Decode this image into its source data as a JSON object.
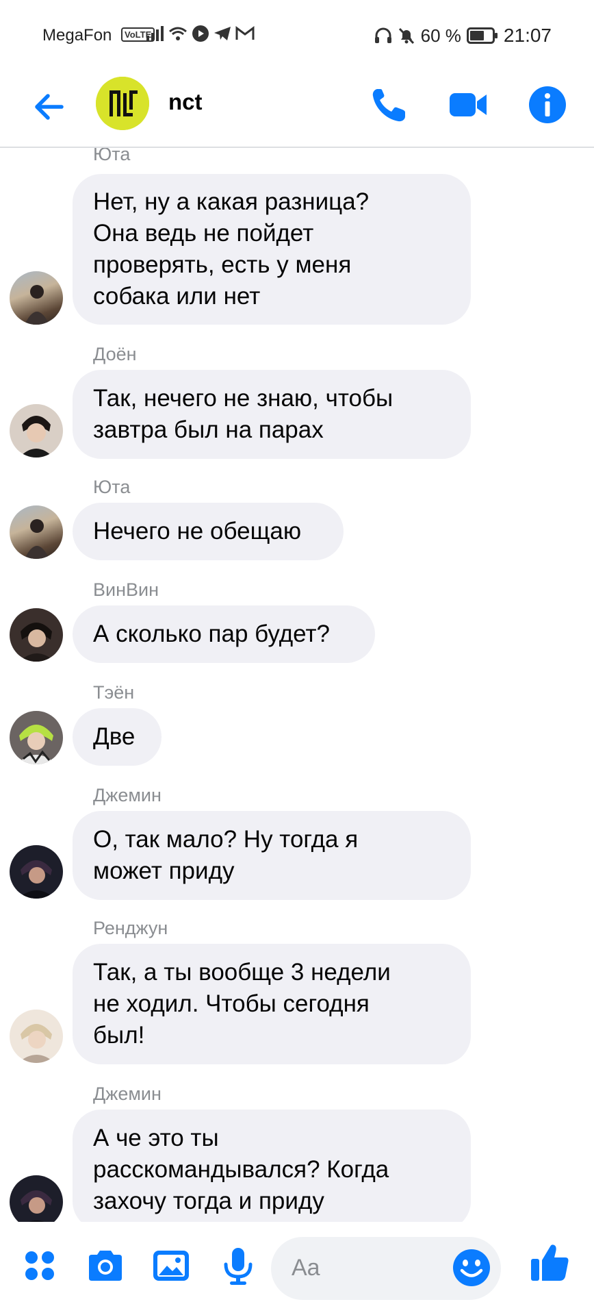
{
  "status_bar": {
    "carrier": "MegaFon",
    "volte": "VoLTE",
    "battery": "60 %",
    "time": "21:07"
  },
  "header": {
    "group_name": "nct",
    "accent": "#0a7cff"
  },
  "messages": [
    {
      "sender": "Юта",
      "lines": [
        "Нет, ну а какая разница?",
        "Она ведь не пойдет",
        "проверять, есть у меня",
        "собака или нет"
      ]
    },
    {
      "sender": "Доён",
      "lines": [
        "Так, нечего не знаю, чтобы",
        "завтра был на парах"
      ]
    },
    {
      "sender": "Юта",
      "lines": [
        "Нечего не обещаю"
      ]
    },
    {
      "sender": "ВинВин",
      "lines": [
        "А сколько пар будет?"
      ]
    },
    {
      "sender": "Тэён",
      "lines": [
        "Две"
      ]
    },
    {
      "sender": "Джемин",
      "lines": [
        "О, так мало? Ну тогда я",
        "может приду"
      ]
    },
    {
      "sender": "Ренджун",
      "lines": [
        "Так, а ты вообще 3 недели",
        "не ходил. Чтобы сегодня",
        "был!"
      ]
    },
    {
      "sender": "Джемин",
      "lines": [
        "А че это ты",
        "расскомандывался? Когда",
        "захочу тогда и приду"
      ]
    }
  ],
  "composer": {
    "placeholder": "Aa"
  }
}
